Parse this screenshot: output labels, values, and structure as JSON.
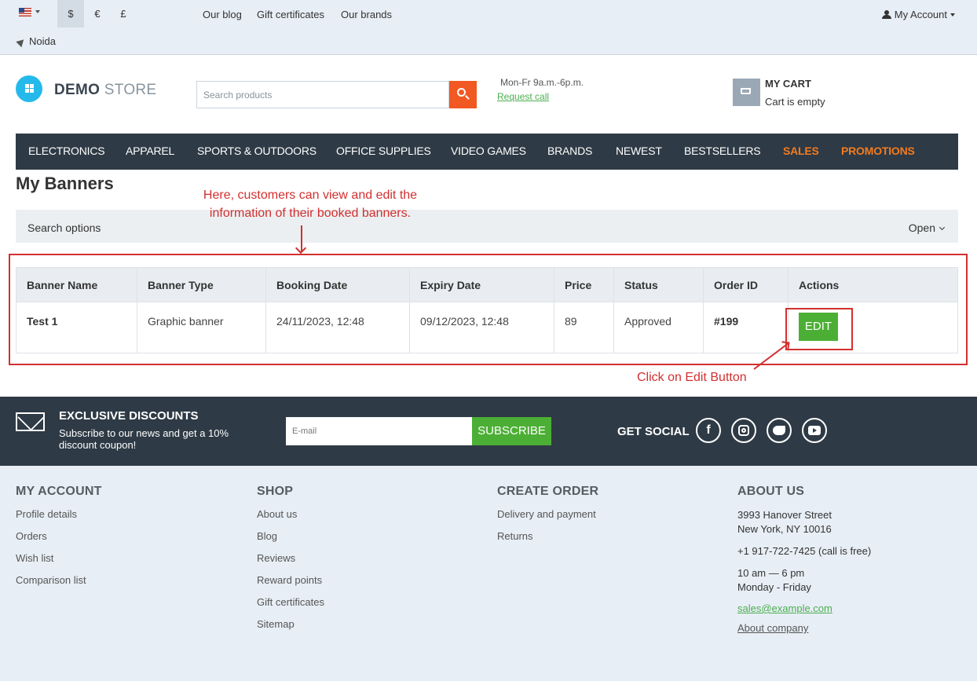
{
  "topbar": {
    "currencies": [
      "$",
      "€",
      "£"
    ],
    "links": [
      "Our blog",
      "Gift certificates",
      "Our brands"
    ],
    "location": "Noida",
    "account": "My Account"
  },
  "header": {
    "logo_bold": "DEMO",
    "logo_light": "STORE",
    "search_placeholder": "Search products",
    "hours": "Mon-Fr 9a.m.-6p.m.",
    "request_call": "Request call",
    "cart_title": "MY CART",
    "cart_status": "Cart is empty"
  },
  "nav": [
    "ELECTRONICS",
    "APPAREL",
    "SPORTS & OUTDOORS",
    "OFFICE SUPPLIES",
    "VIDEO GAMES",
    "BRANDS",
    "NEWEST",
    "BESTSELLERS",
    "SALES",
    "PROMOTIONS"
  ],
  "page": {
    "title": "My Banners",
    "annotation_top": "Here, customers can view and edit the information of their booked banners.",
    "search_options": "Search options",
    "open_label": "Open",
    "annotation_edit": "Click on Edit Button"
  },
  "table": {
    "headers": [
      "Banner Name",
      "Banner Type",
      "Booking Date",
      "Expiry Date",
      "Price",
      "Status",
      "Order ID",
      "Actions"
    ],
    "rows": [
      {
        "name": "Test 1",
        "type": "Graphic banner",
        "booking": "24/11/2023, 12:48",
        "expiry": "09/12/2023, 12:48",
        "price": "89",
        "status": "Approved",
        "order_id": "#199",
        "action": "EDIT"
      }
    ]
  },
  "subscribe": {
    "title": "EXCLUSIVE DISCOUNTS",
    "text": "Subscribe to our news and get a 10% discount coupon!",
    "email_placeholder": "E-mail",
    "button": "SUBSCRIBE",
    "social_title": "GET SOCIAL",
    "social_icons": [
      "facebook-icon",
      "instagram-icon",
      "twitter-icon",
      "youtube-icon"
    ]
  },
  "footer": {
    "my_account": {
      "title": "MY ACCOUNT",
      "links": [
        "Profile details",
        "Orders",
        "Wish list",
        "Comparison list"
      ]
    },
    "shop": {
      "title": "SHOP",
      "links": [
        "About us",
        "Blog",
        "Reviews",
        "Reward points",
        "Gift certificates",
        "Sitemap"
      ]
    },
    "create_order": {
      "title": "CREATE ORDER",
      "links": [
        "Delivery and payment",
        "Returns"
      ]
    },
    "about_us": {
      "title": "ABOUT US",
      "address_1": "3993 Hanover Street",
      "address_2": "New York, NY 10016",
      "phone": "+1 917-722-7425 (call is free)",
      "hours_1": "10 am — 6 pm",
      "hours_2": "Monday - Friday",
      "email": "sales@example.com",
      "about_company": "About company"
    }
  },
  "colors": {
    "accent_orange": "#f25822",
    "green": "#4caf35",
    "annotation_red": "#d32f2f",
    "dark": "#2e3a45"
  }
}
